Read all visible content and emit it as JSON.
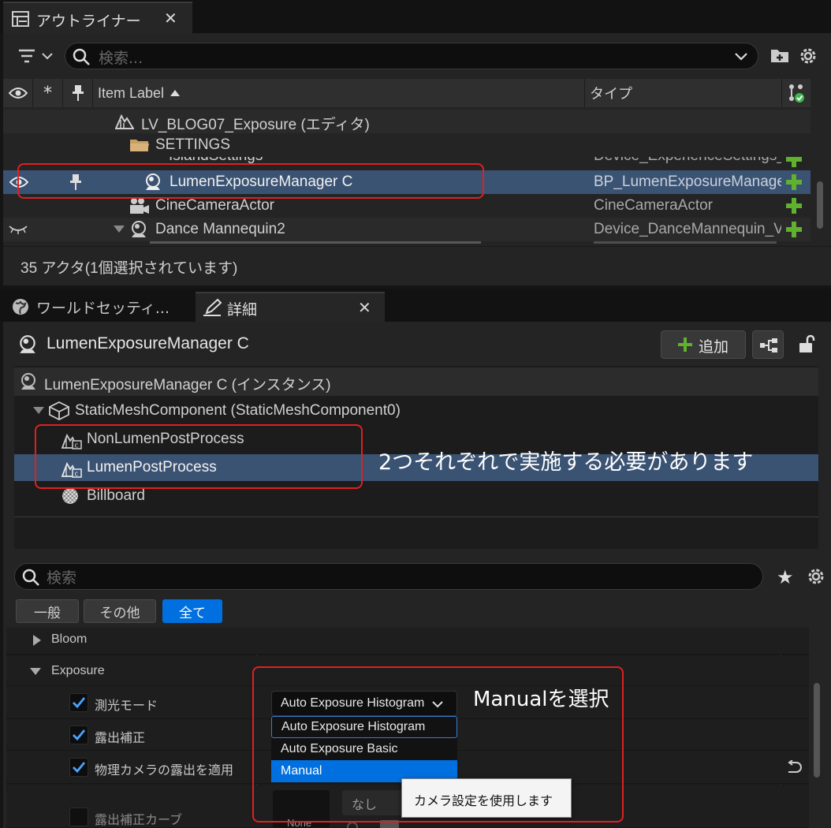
{
  "outliner": {
    "tab_title": "アウトライナー",
    "search_placeholder": "検索...",
    "columns": {
      "item_label": "Item Label",
      "type": "タイプ"
    },
    "rows": [
      {
        "label": "LV_BLOG07_Exposure (エディタ)",
        "type": "",
        "icon": "level-icon"
      },
      {
        "label": "SETTINGS",
        "type": "",
        "icon": "folder-icon"
      },
      {
        "label": "IslandSettings",
        "type": "Device_ExperienceSettings_",
        "icon": "settings-icon"
      },
      {
        "label": "LumenExposureManager C",
        "type": "BP_LumenExposureManage",
        "icon": "actor-icon"
      },
      {
        "label": "CineCameraActor",
        "type": "CineCameraActor",
        "icon": "camera-icon"
      },
      {
        "label": "Dance Mannequin2",
        "type": "Device_DanceMannequin_V",
        "icon": "actor-icon"
      }
    ],
    "status": "35 アクタ(1個選択されています)"
  },
  "details": {
    "tab_world": "ワールドセッティ...",
    "tab_details": "詳細",
    "actor_name": "LumenExposureManager C",
    "add_button": "追加",
    "components": [
      "LumenExposureManager C (インスタンス)",
      "StaticMeshComponent (StaticMeshComponent0)",
      "NonLumenPostProcess",
      "LumenPostProcess",
      "Billboard"
    ],
    "search_placeholder": "検索",
    "filters": [
      "一般",
      "その他",
      "全て"
    ],
    "sections": {
      "bloom": "Bloom",
      "exposure": "Exposure"
    },
    "properties": {
      "metering_mode": "測光モード",
      "exposure_compensation": "露出補正",
      "apply_physical_camera": "物理カメラの露出を適用",
      "exposure_curve": "露出補正カーブ"
    },
    "metering_value": "Auto Exposure Histogram",
    "dropdown_options": [
      "Auto Exposure Histogram",
      "Auto Exposure Basic",
      "Manual"
    ],
    "tooltip": "カメラ設定を使用します",
    "curve_none": "None",
    "curve_value": "なし"
  },
  "annotations": {
    "note_components": "2つそれぞれで実施する必要があります",
    "note_manual": "Manualを選択"
  },
  "colors": {
    "selection": "#3b5373",
    "accent": "#0070e0",
    "plus": "#5fb12e",
    "annot": "#e02020"
  }
}
